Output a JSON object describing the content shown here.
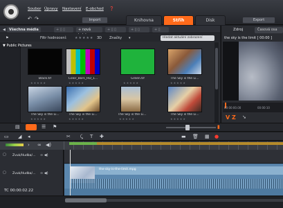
{
  "menu": {
    "file": "Soubor",
    "edit": "Úpravy",
    "settings": "Nastavení",
    "shop": "E-obchod"
  },
  "toolbar": {
    "import": "Import",
    "export": "Export"
  },
  "tabs": {
    "library": "Knihovna",
    "edit": "Střih",
    "disc": "Disk"
  },
  "library": {
    "tab_all": "Všechna média",
    "tab_collection": "+ nová kolekce",
    "filter_label": "Filtr hodnocení:",
    "filter_3d": "3D",
    "filter_tags": "Značky",
    "search_placeholder": "Hledat aktuální zobrazení",
    "nav_label": "Public Pictures",
    "items": [
      {
        "label": "Black.tif",
        "stars": "★★★★★"
      },
      {
        "label": "Color_Bars_HD_1...",
        "stars": "★★★★★"
      },
      {
        "label": "Green.tif",
        "stars": "★★★★★"
      },
      {
        "label": "The Sky is the Li...",
        "stars": "★★★★★"
      },
      {
        "label": "The Sky is the Li...",
        "stars": "★★★★★"
      },
      {
        "label": "The Sky is the Li...",
        "stars": "★★★★★"
      },
      {
        "label": "The Sky is the Li...",
        "stars": "★★★★★"
      },
      {
        "label": "The Sky is the Li...",
        "stars": "★★★★★"
      }
    ]
  },
  "player": {
    "source_label": "Zdroj",
    "timeline_label": "Časová osa",
    "clip_title": "the sky is the limit  [ 00:00 ]",
    "tc_start": "00:00:00.00",
    "tc_end": "00:00:10",
    "marks": "V Z"
  },
  "timeline": {
    "track1_name": "Zvuk/Hudba/...",
    "track2_name": "Zvuk/Hudba/...",
    "clip_label": "the-sky-is-the-limit.mpg",
    "timecode": "TC  00:00:02.22"
  },
  "colors": {
    "accent": "#ff6a1a",
    "track": "#5b87ae"
  }
}
